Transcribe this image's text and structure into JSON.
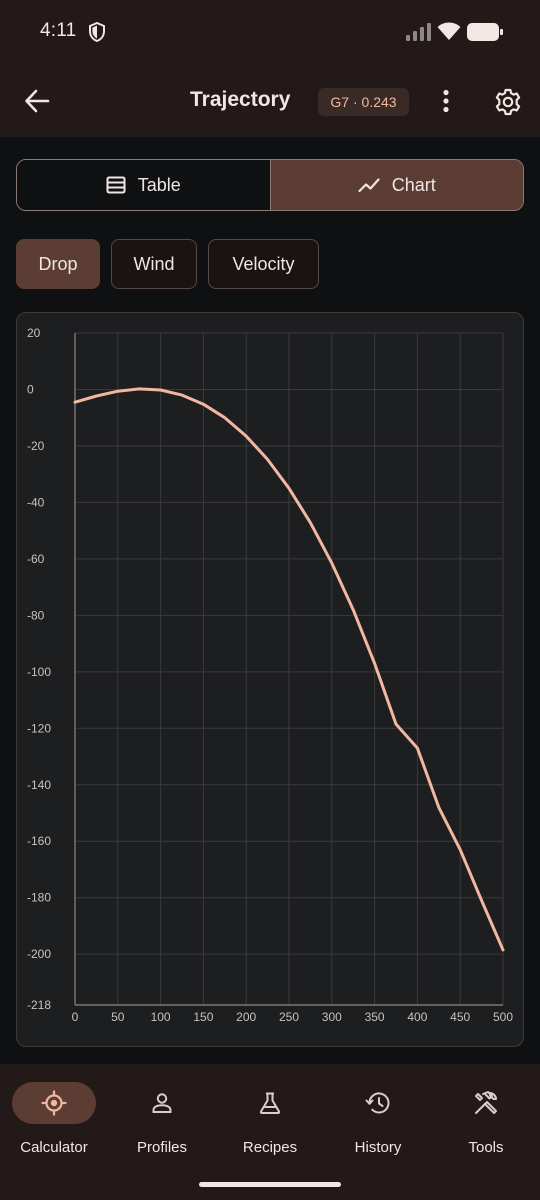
{
  "status": {
    "time": "4:11"
  },
  "appbar": {
    "title": "Trajectory",
    "bc_chip": "G7 · 0.243"
  },
  "view_toggle": {
    "table_label": "Table",
    "chart_label": "Chart",
    "selected": "Chart"
  },
  "chips": [
    {
      "label": "Drop",
      "selected": true
    },
    {
      "label": "Wind",
      "selected": false
    },
    {
      "label": "Velocity",
      "selected": false
    }
  ],
  "colors": {
    "accent": "#5c3d34",
    "curve": "#f2b7a1",
    "background": "#0f1012",
    "bar": "#231918"
  },
  "chart_data": {
    "type": "line",
    "title": "",
    "xlabel": "",
    "ylabel": "",
    "xlim": [
      0,
      500
    ],
    "ylim": [
      -218,
      20
    ],
    "x_ticks": [
      0,
      50,
      100,
      150,
      200,
      250,
      300,
      350,
      400,
      450,
      500
    ],
    "y_ticks": [
      20,
      0,
      -20,
      -40,
      -60,
      -80,
      -100,
      -120,
      -140,
      -160,
      -180,
      -200,
      -218
    ],
    "grid": true,
    "series": [
      {
        "x": [
          0,
          25,
          50,
          75,
          100,
          125,
          150,
          175,
          200,
          225,
          250,
          275,
          300,
          325,
          350,
          375,
          400,
          425,
          450,
          475,
          500
        ],
        "values": [
          -4.5,
          -2.3,
          -0.6,
          0.2,
          -0.2,
          -2.0,
          -5.2,
          -10.0,
          -16.5,
          -24.8,
          -35.0,
          -47.2,
          -61.5,
          -78.0,
          -97.0,
          -118.5,
          -127.0,
          -148.0,
          -163.0,
          -181.0,
          -198.5
        ]
      }
    ]
  },
  "bottom_nav": [
    {
      "label": "Calculator",
      "icon": "crosshair-icon",
      "active": true
    },
    {
      "label": "Profiles",
      "icon": "person-icon",
      "active": false
    },
    {
      "label": "Recipes",
      "icon": "flask-icon",
      "active": false
    },
    {
      "label": "History",
      "icon": "history-icon",
      "active": false
    },
    {
      "label": "Tools",
      "icon": "tools-icon",
      "active": false
    }
  ]
}
